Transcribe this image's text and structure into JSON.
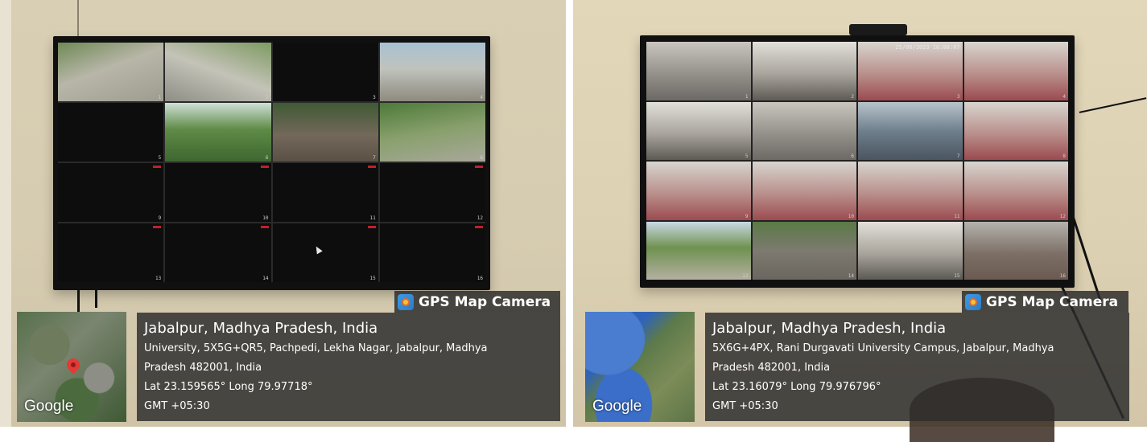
{
  "left": {
    "gps_label": "GPS Map Camera",
    "map_label": "Google",
    "location_title": "Jabalpur, Madhya Pradesh, India",
    "address_line1": "University, 5X5G+QR5, Pachpedi, Lekha Nagar, Jabalpur, Madhya",
    "address_line2": "Pradesh 482001, India",
    "coordinates": "Lat 23.159565° Long 79.97718°",
    "timezone": "GMT +05:30",
    "cells": [
      {
        "feed": "f-road1",
        "num": "1"
      },
      {
        "feed": "f-road2",
        "num": "2"
      },
      {
        "feed": "dark",
        "num": "3"
      },
      {
        "feed": "f-gate",
        "num": "4"
      },
      {
        "feed": "dark",
        "num": "5"
      },
      {
        "feed": "f-green1",
        "num": "6"
      },
      {
        "feed": "f-park",
        "num": "7"
      },
      {
        "feed": "f-green2",
        "num": "8"
      },
      {
        "feed": "dark",
        "num": "9",
        "rec": true
      },
      {
        "feed": "dark",
        "num": "10",
        "rec": true
      },
      {
        "feed": "dark",
        "num": "11",
        "rec": true
      },
      {
        "feed": "dark",
        "num": "12",
        "rec": true
      },
      {
        "feed": "dark",
        "num": "13",
        "rec": true
      },
      {
        "feed": "dark",
        "num": "14",
        "rec": true
      },
      {
        "feed": "dark",
        "num": "15",
        "rec": true
      },
      {
        "feed": "dark",
        "num": "16",
        "rec": true
      }
    ]
  },
  "right": {
    "gps_label": "GPS Map Camera",
    "map_label": "Google",
    "location_title": "Jabalpur, Madhya Pradesh, India",
    "address_line1": "5X6G+4PX, Rani Durgavati University Campus, Jabalpur, Madhya",
    "address_line2": "Pradesh 482001, India",
    "coordinates": "Lat 23.16079° Long 79.976796°",
    "timezone": "GMT +05:30",
    "screen_timestamp": "25/08/2023 16:08:07",
    "cells": [
      {
        "feed": "f-room",
        "num": "1"
      },
      {
        "feed": "f-hall",
        "num": "2"
      },
      {
        "feed": "f-red",
        "num": "3"
      },
      {
        "feed": "f-red",
        "num": "4"
      },
      {
        "feed": "f-hall",
        "num": "5"
      },
      {
        "feed": "f-room",
        "num": "6"
      },
      {
        "feed": "f-office",
        "num": "7"
      },
      {
        "feed": "f-red",
        "num": "8"
      },
      {
        "feed": "f-red",
        "num": "9"
      },
      {
        "feed": "f-red",
        "num": "10"
      },
      {
        "feed": "f-red",
        "num": "11"
      },
      {
        "feed": "f-red",
        "num": "12"
      },
      {
        "feed": "f-lawn",
        "num": "13"
      },
      {
        "feed": "f-lot",
        "num": "14"
      },
      {
        "feed": "f-hall",
        "num": "15"
      },
      {
        "feed": "f-wet",
        "num": "16"
      }
    ]
  }
}
